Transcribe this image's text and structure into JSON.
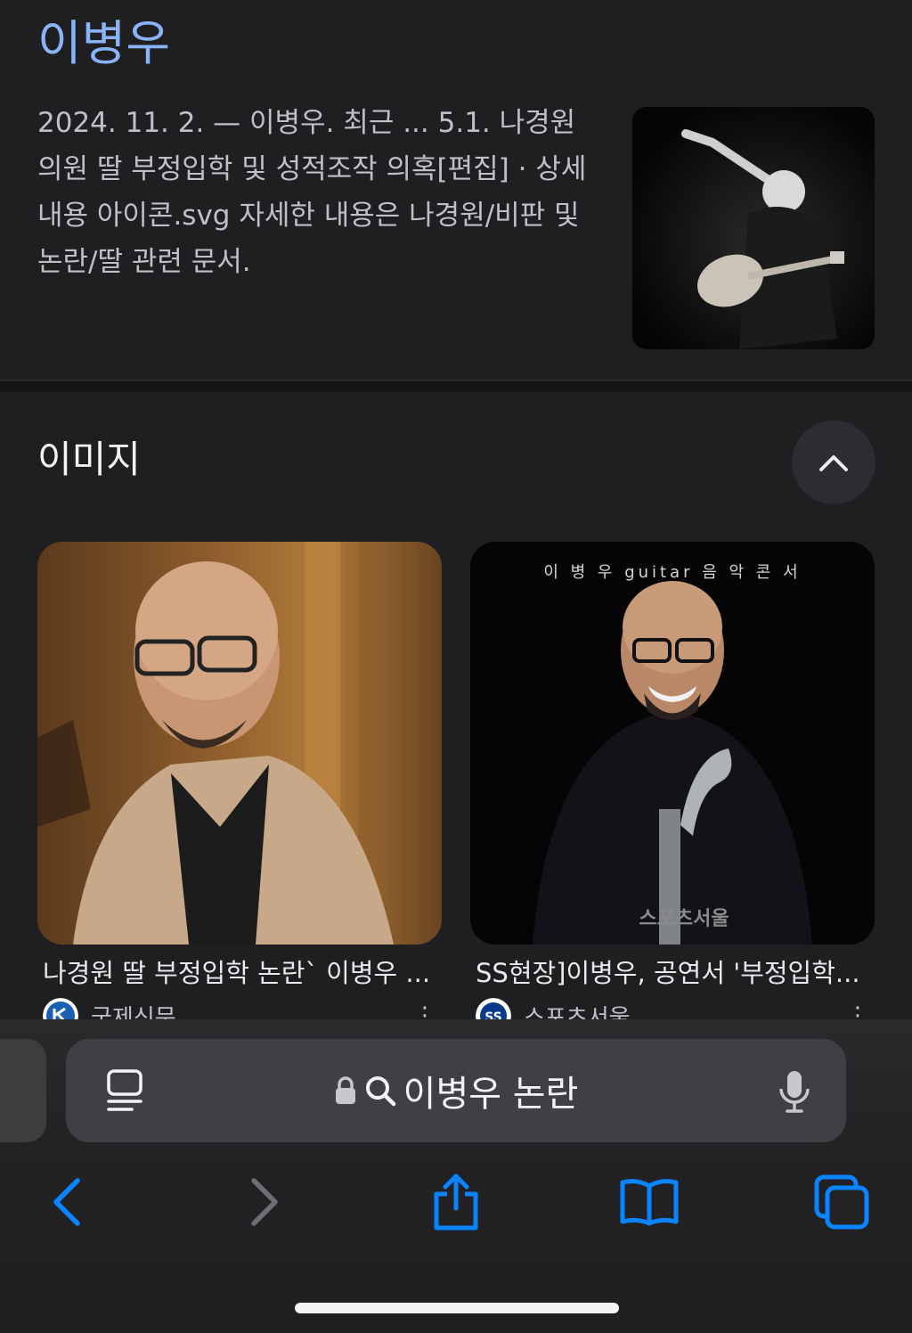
{
  "result": {
    "title": "이병우",
    "snippet": "2024. 11. 2. — 이병우. 최근 ... 5.1. 나경원 의원 딸 부정입학 및 성적조작 의혹[편집] · 상세 내용 아이콘.svg 자세한 내용은 나경원/비판 및 논란/딸 관련 문서."
  },
  "images": {
    "heading": "이미지",
    "cards": [
      {
        "caption": "나경원 딸 부정입학 논란` 이병우 ...",
        "source": "국제신문"
      },
      {
        "caption": "SS현장]이병우, 공연서 '부정입학...",
        "source": "스포츠서울",
        "photo_text": "이 병 우  guitar 음 악 콘 서",
        "watermark": "스포츠서울"
      }
    ]
  },
  "toolbar": {
    "search_query": "이병우 논란"
  },
  "colors": {
    "background": "#1f1f21",
    "link_blue": "#8ab4f8",
    "accent_blue": "#0a84ff"
  }
}
